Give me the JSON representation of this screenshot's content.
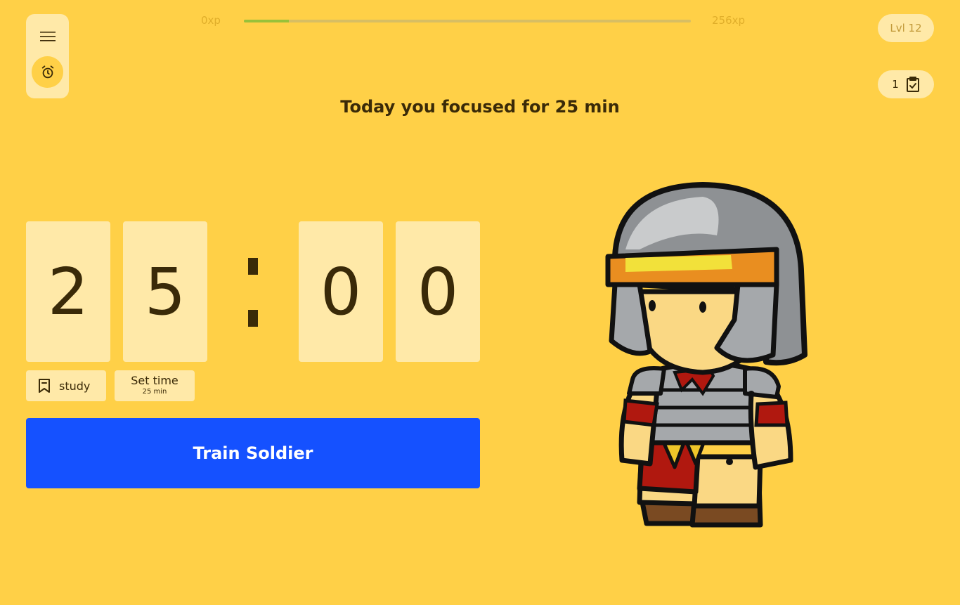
{
  "xp": {
    "min_label": "0xp",
    "max_label": "256xp",
    "progress": 0.1
  },
  "level": {
    "label": "Lvl 12"
  },
  "tasks": {
    "count": "1"
  },
  "headline": "Today you focused for 25 min",
  "timer": {
    "d1": "2",
    "d2": "5",
    "d3": "0",
    "d4": "0"
  },
  "tag": {
    "label": "study"
  },
  "set_time": {
    "label": "Set time",
    "value": "25 min"
  },
  "train_button": {
    "label": "Train Soldier"
  },
  "colors": {
    "background": "#FFD047",
    "card": "#FFE9A8",
    "accent": "#1551FF",
    "xp_fill": "#98C13A"
  },
  "icons": [
    "menu-icon",
    "alarm-clock-icon",
    "clipboard-check-icon",
    "bookmark-icon"
  ]
}
